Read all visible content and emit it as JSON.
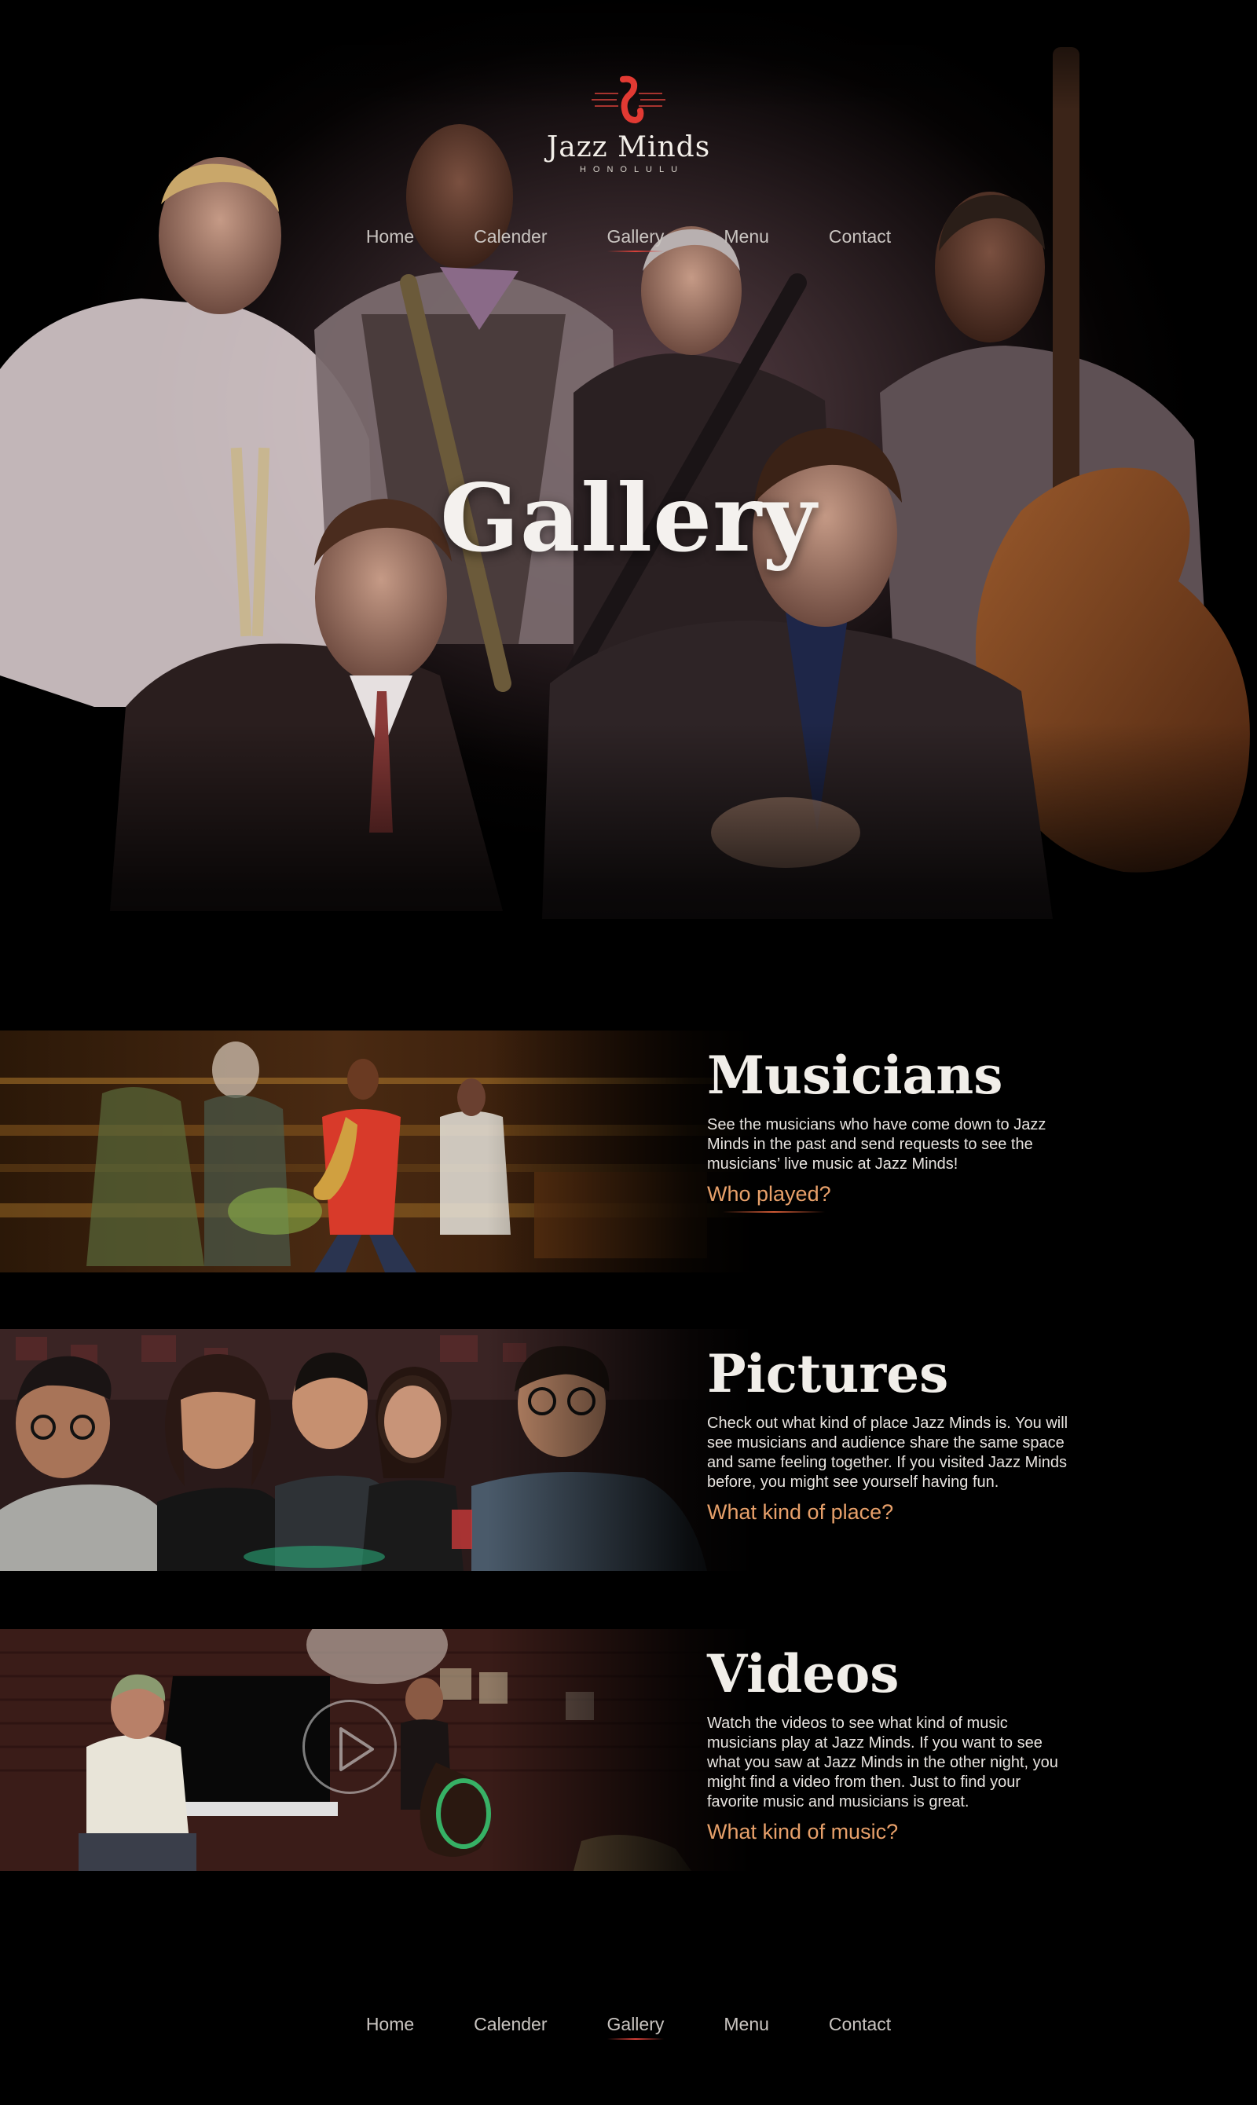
{
  "brand": {
    "name": "Jazz Minds",
    "location": "HONOLULU",
    "logo_icon": "saxophone-logo-icon",
    "accent": "#d8413a"
  },
  "nav": {
    "items": [
      "Home",
      "Calender",
      "Gallery",
      "Menu",
      "Contact"
    ],
    "active": "Gallery"
  },
  "hero": {
    "title": "Gallery",
    "image": "band-portrait-photo"
  },
  "sections": [
    {
      "title": "Musicians",
      "body": "See the musicians who have come down to Jazz Minds in the past and send requests to see the musicians’ live music at Jazz Minds!",
      "link": "Who played?",
      "image": "live-performance-photo"
    },
    {
      "title": "Pictures",
      "body": "Check out what kind of place Jazz Minds is. You will see musicians and audience share the same space and same feeling together. If you visited Jazz Minds before, you might see yourself having fun.",
      "link": "What kind of place?",
      "image": "audience-photo"
    },
    {
      "title": "Videos",
      "body": "Watch the videos to see what kind of music musicians play at Jazz Minds. If you want to see what you saw at Jazz Minds in the other night, you might find a video from then. Just to find your favorite music and musicians is great.",
      "link": "What kind of music?",
      "image": "piano-bass-video-thumbnail",
      "play_icon": "play-icon"
    }
  ],
  "colors": {
    "background": "#000000",
    "link": "#e7a06a",
    "heading": "#f1eee9"
  }
}
